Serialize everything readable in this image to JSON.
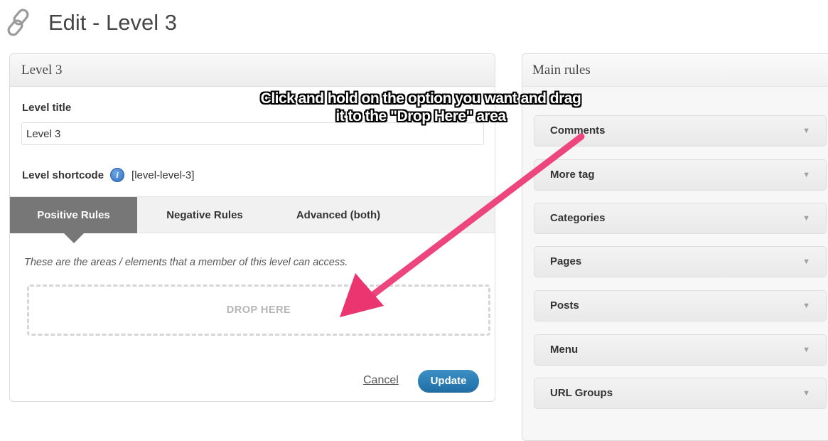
{
  "header": {
    "title": "Edit - Level 3",
    "icon": "link-icon"
  },
  "level_panel": {
    "heading": "Level 3",
    "title_label": "Level title",
    "title_value": "Level 3",
    "shortcode_label": "Level shortcode",
    "shortcode_value": "[level-level-3]",
    "tabs": [
      {
        "label": "Positive Rules",
        "active": true
      },
      {
        "label": "Negative Rules",
        "active": false
      },
      {
        "label": "Advanced (both)",
        "active": false
      }
    ],
    "description": "These are the areas / elements that a member of this level can access.",
    "drop_zone_label": "DROP HERE",
    "cancel_label": "Cancel",
    "update_label": "Update"
  },
  "rules_panel": {
    "heading": "Main rules",
    "items": [
      {
        "label": "Comments"
      },
      {
        "label": "More tag"
      },
      {
        "label": "Categories"
      },
      {
        "label": "Pages"
      },
      {
        "label": "Posts"
      },
      {
        "label": "Menu"
      },
      {
        "label": "URL Groups"
      }
    ]
  },
  "annotation": {
    "line1": "Click and hold on the option you want and drag",
    "line2": "it to the \"Drop Here\" area"
  },
  "colors": {
    "accent": "#2a7ab5",
    "active_tab": "#777777",
    "annotation_arrow": "#ee3c78"
  }
}
